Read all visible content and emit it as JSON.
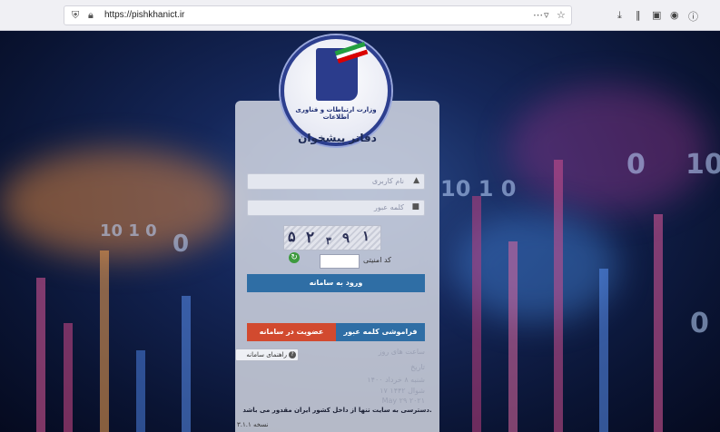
{
  "browser": {
    "url": "https://pishkhanict.ir",
    "icons": [
      "shield-icon",
      "lock-icon",
      "more-icon",
      "pocket-icon",
      "star-icon",
      "download-icon",
      "library-icon",
      "sidebar-icon",
      "account-icon",
      "extension-icon"
    ]
  },
  "background": {
    "numerals": [
      "10 1 0",
      "0",
      "10 1 0",
      "0",
      "10",
      "0"
    ]
  },
  "logo": {
    "ministry": "وزارت ارتباطات و فناوری اطلاعات"
  },
  "card": {
    "title": "دفاتر پیشخوان"
  },
  "form": {
    "username_placeholder": "نام کاربری",
    "password_placeholder": "کلمه عبور",
    "captcha_label": "کد امنیتی",
    "captcha_chars": [
      "۵",
      "۲",
      "۳",
      "۹",
      "۱"
    ]
  },
  "buttons": {
    "login": "ورود به سامانه",
    "forgot": "فراموشی کلمه عبور",
    "register": "عضویت در سامانه",
    "help": "راهنمای سامانه"
  },
  "info": {
    "hours": "ساعت های روز",
    "date_label": "تاریخ",
    "date_shamsi": "شنبه ۸ خرداد ۱۴۰۰",
    "date_hijri": "۱۷ شوال ۱۴۴۲",
    "date_gregorian": "May ۲۹ ۲۰۲۱",
    "access_note": "دسترسی به سایت تنها از داخل کشور ایران مقدور می باشد.",
    "version": "نسخه ۳.۱.۱"
  },
  "colors": {
    "login_button": "#2f6ea5",
    "register_button": "#d24a2f",
    "logo_blue": "#2d3f8f"
  }
}
